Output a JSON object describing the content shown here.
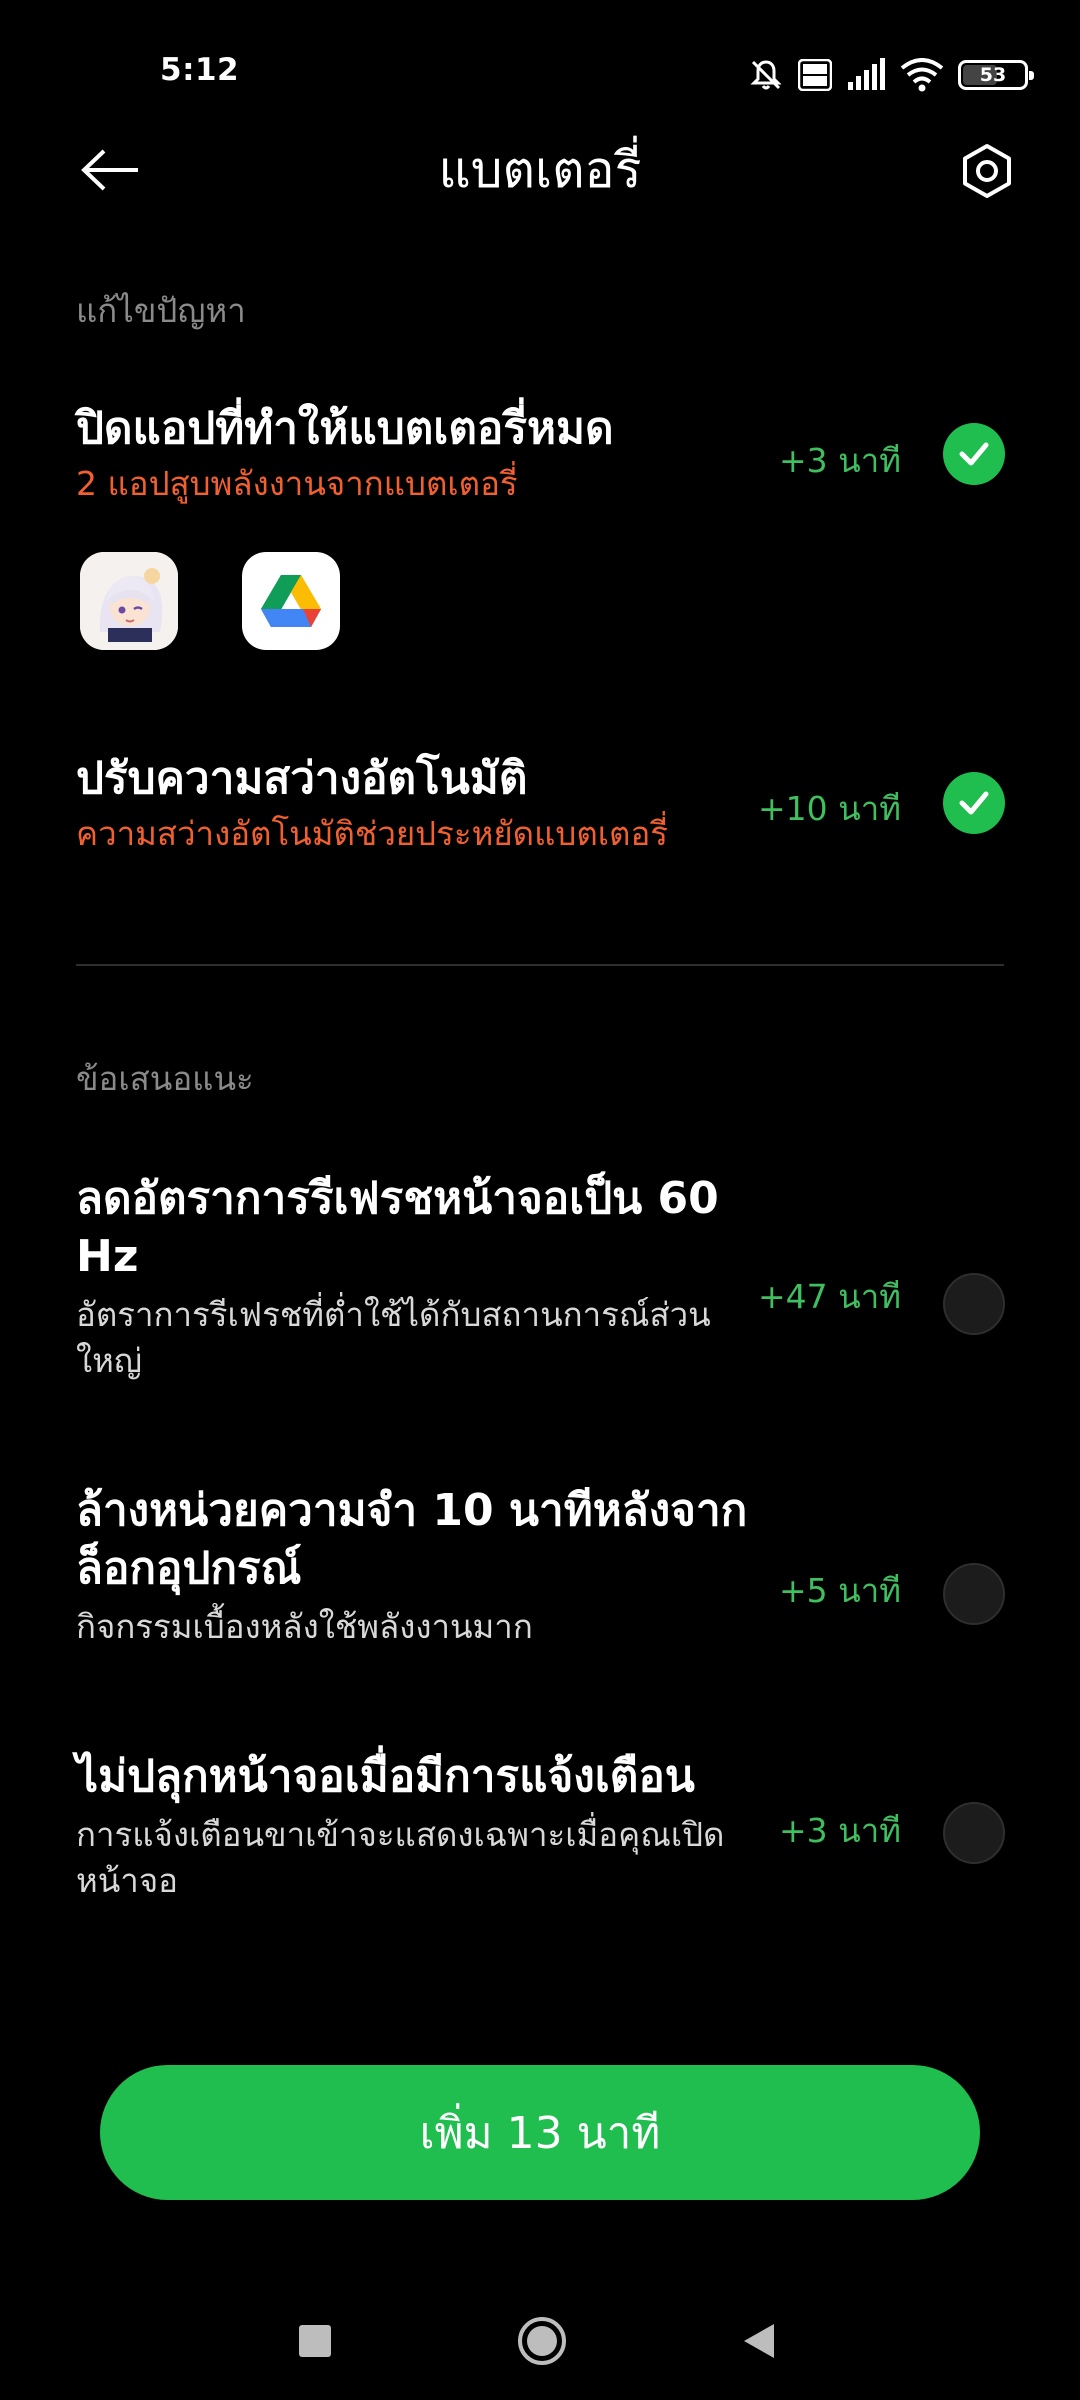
{
  "status_bar": {
    "time": "5:12",
    "battery": "53",
    "battery_level": 0.53,
    "icons": [
      "mute-icon",
      "volte-icon",
      "signal-icon",
      "wifi-icon",
      "battery-icon"
    ]
  },
  "header": {
    "title": "แบตเตอรี่",
    "back_icon": "arrow-left-icon",
    "settings_icon": "settings-hexagon-icon"
  },
  "fix_section": {
    "label": "แก้ไขปัญหา",
    "items": [
      {
        "title": "ปิดแอปที่ทำให้แบตเตอรี่หมด",
        "subtitle": "2 แอปสูบพลังงานจากแบตเตอรี่",
        "gain": "+3 นาที",
        "checked": true,
        "apps": [
          "anime-game-app-icon",
          "google-drive-app-icon"
        ]
      },
      {
        "title": "ปรับความสว่างอัตโนมัติ",
        "subtitle": "ความสว่างอัตโนมัติช่วยประหยัดแบตเตอรี่",
        "gain": "+10 นาที",
        "checked": true
      }
    ]
  },
  "suggest_section": {
    "label": "ข้อเสนอแนะ",
    "items": [
      {
        "title": "ลดอัตราการรีเฟรชหน้าจอเป็น 60 Hz",
        "subtitle": "อัตราการรีเฟรชที่ต่ำใช้ได้กับสถานการณ์ส่วนใหญ่",
        "gain": "+47 นาที",
        "checked": false
      },
      {
        "title": "ล้างหน่วยความจำ 10 นาทีหลังจากล็อกอุปกรณ์",
        "subtitle": "กิจกรรมเบื้องหลังใช้พลังงานมาก",
        "gain": "+5 นาที",
        "checked": false
      },
      {
        "title": "ไม่ปลุกหน้าจอเมื่อมีการแจ้งเตือน",
        "subtitle": "การแจ้งเตือนขาเข้าจะแสดงเฉพาะเมื่อคุณเปิดหน้าจอ",
        "gain": "+3 นาที",
        "checked": false
      }
    ]
  },
  "action": {
    "label": "เพิ่ม 13 นาที"
  },
  "colors": {
    "accent_green": "#1fbe4f",
    "gain_green": "#3fbf5f",
    "warning_orange": "#f2602f",
    "background": "#000000"
  }
}
